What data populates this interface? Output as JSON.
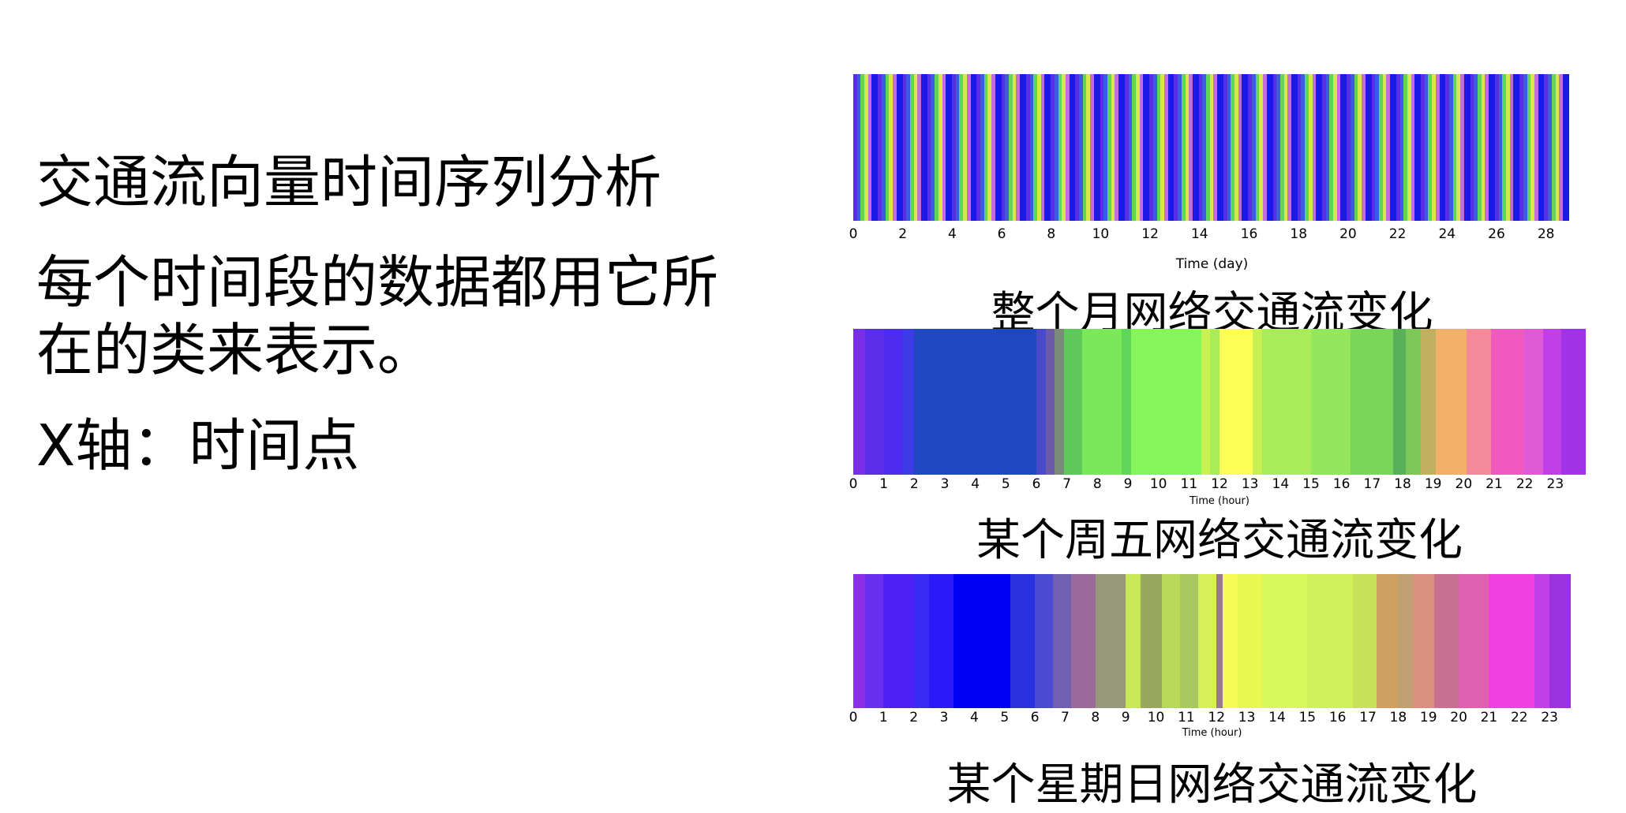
{
  "text": {
    "title": "交通流向量时间序列分析",
    "body": "每个时间段的数据都用它所在的类来表示。",
    "axis_note": "X轴：时间点"
  },
  "chart_data": [
    {
      "type": "heatmap",
      "caption": "整个月网络交通流变化",
      "xlabel": "Time (day)",
      "xlim": [
        0,
        29
      ],
      "ticks": [
        "0",
        "2",
        "4",
        "6",
        "8",
        "10",
        "12",
        "14",
        "16",
        "18",
        "20",
        "22",
        "24",
        "26",
        "28"
      ],
      "segments": [
        {
          "x": 0.0,
          "color": "#5a2ee8"
        },
        {
          "x": 0.15,
          "color": "#3b5be0"
        },
        {
          "x": 0.3,
          "color": "#5fd65a"
        },
        {
          "x": 0.45,
          "color": "#d8e84a"
        },
        {
          "x": 0.6,
          "color": "#c46be0"
        },
        {
          "x": 0.75,
          "color": "#1a1ae8"
        },
        {
          "x": 1.0,
          "color": "#5a2ee8"
        },
        {
          "x": 1.15,
          "color": "#3b5be0"
        },
        {
          "x": 1.3,
          "color": "#5fd65a"
        },
        {
          "x": 1.45,
          "color": "#d8e84a"
        },
        {
          "x": 1.6,
          "color": "#c46be0"
        },
        {
          "x": 1.75,
          "color": "#1a1ae8"
        },
        {
          "x": 2.0,
          "color": "#5a2ee8"
        },
        {
          "x": 2.15,
          "color": "#3b5be0"
        },
        {
          "x": 2.3,
          "color": "#5fd65a"
        },
        {
          "x": 2.45,
          "color": "#d8e84a"
        },
        {
          "x": 2.6,
          "color": "#c46be0"
        },
        {
          "x": 2.75,
          "color": "#1a1ae8"
        },
        {
          "x": 3.0,
          "color": "#5a2ee8"
        },
        {
          "x": 3.15,
          "color": "#3b5be0"
        },
        {
          "x": 3.3,
          "color": "#5fd65a"
        },
        {
          "x": 3.45,
          "color": "#d8e84a"
        },
        {
          "x": 3.6,
          "color": "#c46be0"
        },
        {
          "x": 3.75,
          "color": "#1a1ae8"
        },
        {
          "x": 4.0,
          "color": "#5a2ee8"
        },
        {
          "x": 4.15,
          "color": "#3b5be0"
        },
        {
          "x": 4.3,
          "color": "#5fd65a"
        },
        {
          "x": 4.45,
          "color": "#d8e84a"
        },
        {
          "x": 4.6,
          "color": "#c46be0"
        },
        {
          "x": 4.75,
          "color": "#1a1ae8"
        },
        {
          "x": 5.0,
          "color": "#5a2ee8"
        },
        {
          "x": 5.15,
          "color": "#3b5be0"
        },
        {
          "x": 5.3,
          "color": "#5fd65a"
        },
        {
          "x": 5.45,
          "color": "#d8e84a"
        },
        {
          "x": 5.6,
          "color": "#c46be0"
        },
        {
          "x": 5.75,
          "color": "#1a1ae8"
        },
        {
          "x": 6.0,
          "color": "#5a2ee8"
        },
        {
          "x": 6.15,
          "color": "#3b5be0"
        },
        {
          "x": 6.3,
          "color": "#5fd65a"
        },
        {
          "x": 6.45,
          "color": "#d8e84a"
        },
        {
          "x": 6.6,
          "color": "#c46be0"
        },
        {
          "x": 6.75,
          "color": "#1a1ae8"
        },
        {
          "x": 7.0,
          "color": "#5a2ee8"
        },
        {
          "x": 7.15,
          "color": "#3b5be0"
        },
        {
          "x": 7.3,
          "color": "#5fd65a"
        },
        {
          "x": 7.45,
          "color": "#d8e84a"
        },
        {
          "x": 7.6,
          "color": "#c46be0"
        },
        {
          "x": 7.75,
          "color": "#1a1ae8"
        },
        {
          "x": 8.0,
          "color": "#5a2ee8"
        },
        {
          "x": 8.15,
          "color": "#3b5be0"
        },
        {
          "x": 8.3,
          "color": "#5fd65a"
        },
        {
          "x": 8.45,
          "color": "#d8e84a"
        },
        {
          "x": 8.6,
          "color": "#c46be0"
        },
        {
          "x": 8.75,
          "color": "#1a1ae8"
        },
        {
          "x": 9.0,
          "color": "#5a2ee8"
        },
        {
          "x": 9.15,
          "color": "#3b5be0"
        },
        {
          "x": 9.3,
          "color": "#5fd65a"
        },
        {
          "x": 9.45,
          "color": "#d8e84a"
        },
        {
          "x": 9.6,
          "color": "#c46be0"
        },
        {
          "x": 9.75,
          "color": "#1a1ae8"
        },
        {
          "x": 10.0,
          "color": "#5a2ee8"
        },
        {
          "x": 10.15,
          "color": "#3b5be0"
        },
        {
          "x": 10.3,
          "color": "#5fd65a"
        },
        {
          "x": 10.45,
          "color": "#d8e84a"
        },
        {
          "x": 10.6,
          "color": "#c46be0"
        },
        {
          "x": 10.75,
          "color": "#1a1ae8"
        },
        {
          "x": 11.0,
          "color": "#5a2ee8"
        },
        {
          "x": 11.15,
          "color": "#3b5be0"
        },
        {
          "x": 11.3,
          "color": "#5fd65a"
        },
        {
          "x": 11.45,
          "color": "#d8e84a"
        },
        {
          "x": 11.6,
          "color": "#c46be0"
        },
        {
          "x": 11.75,
          "color": "#1a1ae8"
        },
        {
          "x": 12.0,
          "color": "#5a2ee8"
        },
        {
          "x": 12.15,
          "color": "#3b5be0"
        },
        {
          "x": 12.3,
          "color": "#5fd65a"
        },
        {
          "x": 12.45,
          "color": "#d8e84a"
        },
        {
          "x": 12.6,
          "color": "#c46be0"
        },
        {
          "x": 12.75,
          "color": "#1a1ae8"
        },
        {
          "x": 13.0,
          "color": "#5a2ee8"
        },
        {
          "x": 13.15,
          "color": "#3b5be0"
        },
        {
          "x": 13.3,
          "color": "#5fd65a"
        },
        {
          "x": 13.45,
          "color": "#d8e84a"
        },
        {
          "x": 13.6,
          "color": "#c46be0"
        },
        {
          "x": 13.75,
          "color": "#1a1ae8"
        },
        {
          "x": 14.0,
          "color": "#5a2ee8"
        },
        {
          "x": 14.15,
          "color": "#3b5be0"
        },
        {
          "x": 14.3,
          "color": "#5fd65a"
        },
        {
          "x": 14.45,
          "color": "#d8e84a"
        },
        {
          "x": 14.6,
          "color": "#c46be0"
        },
        {
          "x": 14.75,
          "color": "#1a1ae8"
        },
        {
          "x": 15.0,
          "color": "#5a2ee8"
        },
        {
          "x": 15.15,
          "color": "#3b5be0"
        },
        {
          "x": 15.3,
          "color": "#5fd65a"
        },
        {
          "x": 15.45,
          "color": "#d8e84a"
        },
        {
          "x": 15.6,
          "color": "#c46be0"
        },
        {
          "x": 15.75,
          "color": "#1a1ae8"
        },
        {
          "x": 16.0,
          "color": "#5a2ee8"
        },
        {
          "x": 16.15,
          "color": "#3b5be0"
        },
        {
          "x": 16.3,
          "color": "#5fd65a"
        },
        {
          "x": 16.45,
          "color": "#d8e84a"
        },
        {
          "x": 16.6,
          "color": "#c46be0"
        },
        {
          "x": 16.75,
          "color": "#1a1ae8"
        },
        {
          "x": 17.0,
          "color": "#5a2ee8"
        },
        {
          "x": 17.15,
          "color": "#3b5be0"
        },
        {
          "x": 17.3,
          "color": "#5fd65a"
        },
        {
          "x": 17.45,
          "color": "#d8e84a"
        },
        {
          "x": 17.6,
          "color": "#c46be0"
        },
        {
          "x": 17.75,
          "color": "#1a1ae8"
        },
        {
          "x": 18.0,
          "color": "#5a2ee8"
        },
        {
          "x": 18.15,
          "color": "#3b5be0"
        },
        {
          "x": 18.3,
          "color": "#5fd65a"
        },
        {
          "x": 18.45,
          "color": "#d8e84a"
        },
        {
          "x": 18.6,
          "color": "#c46be0"
        },
        {
          "x": 18.75,
          "color": "#1a1ae8"
        },
        {
          "x": 19.0,
          "color": "#5a2ee8"
        },
        {
          "x": 19.15,
          "color": "#3b5be0"
        },
        {
          "x": 19.3,
          "color": "#5fd65a"
        },
        {
          "x": 19.45,
          "color": "#d8e84a"
        },
        {
          "x": 19.6,
          "color": "#c46be0"
        },
        {
          "x": 19.75,
          "color": "#1a1ae8"
        },
        {
          "x": 20.0,
          "color": "#5a2ee8"
        },
        {
          "x": 20.15,
          "color": "#3b5be0"
        },
        {
          "x": 20.3,
          "color": "#5fd65a"
        },
        {
          "x": 20.45,
          "color": "#d8e84a"
        },
        {
          "x": 20.6,
          "color": "#c46be0"
        },
        {
          "x": 20.75,
          "color": "#1a1ae8"
        },
        {
          "x": 21.0,
          "color": "#5a2ee8"
        },
        {
          "x": 21.15,
          "color": "#3b5be0"
        },
        {
          "x": 21.3,
          "color": "#5fd65a"
        },
        {
          "x": 21.45,
          "color": "#d8e84a"
        },
        {
          "x": 21.6,
          "color": "#c46be0"
        },
        {
          "x": 21.75,
          "color": "#1a1ae8"
        },
        {
          "x": 22.0,
          "color": "#5a2ee8"
        },
        {
          "x": 22.15,
          "color": "#3b5be0"
        },
        {
          "x": 22.3,
          "color": "#5fd65a"
        },
        {
          "x": 22.45,
          "color": "#d8e84a"
        },
        {
          "x": 22.6,
          "color": "#c46be0"
        },
        {
          "x": 22.75,
          "color": "#1a1ae8"
        },
        {
          "x": 23.0,
          "color": "#5a2ee8"
        },
        {
          "x": 23.15,
          "color": "#3b5be0"
        },
        {
          "x": 23.3,
          "color": "#5fd65a"
        },
        {
          "x": 23.45,
          "color": "#d8e84a"
        },
        {
          "x": 23.6,
          "color": "#c46be0"
        },
        {
          "x": 23.75,
          "color": "#1a1ae8"
        },
        {
          "x": 24.0,
          "color": "#5a2ee8"
        },
        {
          "x": 24.15,
          "color": "#3b5be0"
        },
        {
          "x": 24.3,
          "color": "#5fd65a"
        },
        {
          "x": 24.45,
          "color": "#d8e84a"
        },
        {
          "x": 24.6,
          "color": "#c46be0"
        },
        {
          "x": 24.75,
          "color": "#1a1ae8"
        },
        {
          "x": 25.0,
          "color": "#5a2ee8"
        },
        {
          "x": 25.15,
          "color": "#3b5be0"
        },
        {
          "x": 25.3,
          "color": "#5fd65a"
        },
        {
          "x": 25.45,
          "color": "#d8e84a"
        },
        {
          "x": 25.6,
          "color": "#c46be0"
        },
        {
          "x": 25.75,
          "color": "#1a1ae8"
        },
        {
          "x": 26.0,
          "color": "#5a2ee8"
        },
        {
          "x": 26.15,
          "color": "#3b5be0"
        },
        {
          "x": 26.3,
          "color": "#5fd65a"
        },
        {
          "x": 26.45,
          "color": "#d8e84a"
        },
        {
          "x": 26.6,
          "color": "#c46be0"
        },
        {
          "x": 26.75,
          "color": "#1a1ae8"
        },
        {
          "x": 27.0,
          "color": "#5a2ee8"
        },
        {
          "x": 27.15,
          "color": "#3b5be0"
        },
        {
          "x": 27.3,
          "color": "#5fd65a"
        },
        {
          "x": 27.45,
          "color": "#d8e84a"
        },
        {
          "x": 27.6,
          "color": "#c46be0"
        },
        {
          "x": 27.75,
          "color": "#1a1ae8"
        },
        {
          "x": 28.0,
          "color": "#5a2ee8"
        },
        {
          "x": 28.15,
          "color": "#3b5be0"
        },
        {
          "x": 28.3,
          "color": "#5fd65a"
        },
        {
          "x": 28.45,
          "color": "#d8e84a"
        },
        {
          "x": 28.6,
          "color": "#c46be0"
        },
        {
          "x": 28.75,
          "color": "#1a1ae8"
        }
      ]
    },
    {
      "type": "heatmap",
      "caption": "某个周五网络交通流变化",
      "xlabel": "Time (hour)",
      "xlim": [
        0,
        24
      ],
      "ticks": [
        "0",
        "1",
        "2",
        "3",
        "4",
        "5",
        "6",
        "7",
        "8",
        "9",
        "10",
        "11",
        "12",
        "13",
        "14",
        "15",
        "16",
        "17",
        "18",
        "19",
        "20",
        "21",
        "22",
        "23"
      ],
      "segments": [
        {
          "x": 0.0,
          "color": "#7a2ee8"
        },
        {
          "x": 0.4,
          "color": "#5a2ee8"
        },
        {
          "x": 1.0,
          "color": "#4d2cf0"
        },
        {
          "x": 1.6,
          "color": "#3d3ae8"
        },
        {
          "x": 2.0,
          "color": "#1f48c0"
        },
        {
          "x": 6.0,
          "color": "#4a4ac8"
        },
        {
          "x": 6.3,
          "color": "#6a5aa8"
        },
        {
          "x": 6.6,
          "color": "#7a8a7a"
        },
        {
          "x": 6.9,
          "color": "#5fc85a"
        },
        {
          "x": 7.5,
          "color": "#7ae85a"
        },
        {
          "x": 8.8,
          "color": "#5fd65a"
        },
        {
          "x": 9.1,
          "color": "#86f55a"
        },
        {
          "x": 11.4,
          "color": "#c8f050"
        },
        {
          "x": 11.7,
          "color": "#a8ec58"
        },
        {
          "x": 12.0,
          "color": "#fdfd55"
        },
        {
          "x": 13.1,
          "color": "#c8f050"
        },
        {
          "x": 13.4,
          "color": "#a9ec5a"
        },
        {
          "x": 15.0,
          "color": "#94e65c"
        },
        {
          "x": 16.3,
          "color": "#7ad65a"
        },
        {
          "x": 17.7,
          "color": "#58b058"
        },
        {
          "x": 18.1,
          "color": "#7ec858"
        },
        {
          "x": 18.6,
          "color": "#c0b060"
        },
        {
          "x": 19.1,
          "color": "#f2b06a"
        },
        {
          "x": 20.1,
          "color": "#f28a9a"
        },
        {
          "x": 20.9,
          "color": "#f05ac0"
        },
        {
          "x": 22.0,
          "color": "#e05ad8"
        },
        {
          "x": 22.6,
          "color": "#c040e8"
        },
        {
          "x": 23.2,
          "color": "#a232e8"
        }
      ]
    },
    {
      "type": "heatmap",
      "caption": "某个星期日网络交通流变化",
      "xlabel": "Time (hour)",
      "xlim": [
        0,
        23.7
      ],
      "ticks": [
        "0",
        "1",
        "2",
        "3",
        "4",
        "5",
        "6",
        "7",
        "8",
        "9",
        "10",
        "11",
        "12",
        "13",
        "14",
        "15",
        "16",
        "17",
        "18",
        "19",
        "20",
        "21",
        "22",
        "23"
      ],
      "segments": [
        {
          "x": 0.0,
          "color": "#8a2ee8"
        },
        {
          "x": 0.4,
          "color": "#6a2ef0"
        },
        {
          "x": 1.0,
          "color": "#4d20f5"
        },
        {
          "x": 2.0,
          "color": "#3a2cf5"
        },
        {
          "x": 2.5,
          "color": "#2a1af8"
        },
        {
          "x": 3.3,
          "color": "#0000f5"
        },
        {
          "x": 5.2,
          "color": "#2a30e0"
        },
        {
          "x": 6.0,
          "color": "#4a4ad0"
        },
        {
          "x": 6.6,
          "color": "#7060b0"
        },
        {
          "x": 7.2,
          "color": "#9a6a9a"
        },
        {
          "x": 8.0,
          "color": "#98987a"
        },
        {
          "x": 9.0,
          "color": "#c8e858"
        },
        {
          "x": 9.5,
          "color": "#98a860"
        },
        {
          "x": 10.2,
          "color": "#b8d858"
        },
        {
          "x": 10.8,
          "color": "#a8c860"
        },
        {
          "x": 11.4,
          "color": "#d8f058"
        },
        {
          "x": 12.0,
          "color": "#9a7a8a"
        },
        {
          "x": 12.2,
          "color": "#f8fa55"
        },
        {
          "x": 12.7,
          "color": "#e8f850"
        },
        {
          "x": 13.5,
          "color": "#d8f85a"
        },
        {
          "x": 15.0,
          "color": "#d0f05a"
        },
        {
          "x": 16.5,
          "color": "#c8e05a"
        },
        {
          "x": 17.3,
          "color": "#d0a060"
        },
        {
          "x": 18.0,
          "color": "#c0a070"
        },
        {
          "x": 18.5,
          "color": "#d89080"
        },
        {
          "x": 19.2,
          "color": "#c87090"
        },
        {
          "x": 20.0,
          "color": "#e060b0"
        },
        {
          "x": 21.0,
          "color": "#f040e0"
        },
        {
          "x": 22.5,
          "color": "#c040e8"
        },
        {
          "x": 23.0,
          "color": "#9a32e0"
        }
      ]
    }
  ]
}
